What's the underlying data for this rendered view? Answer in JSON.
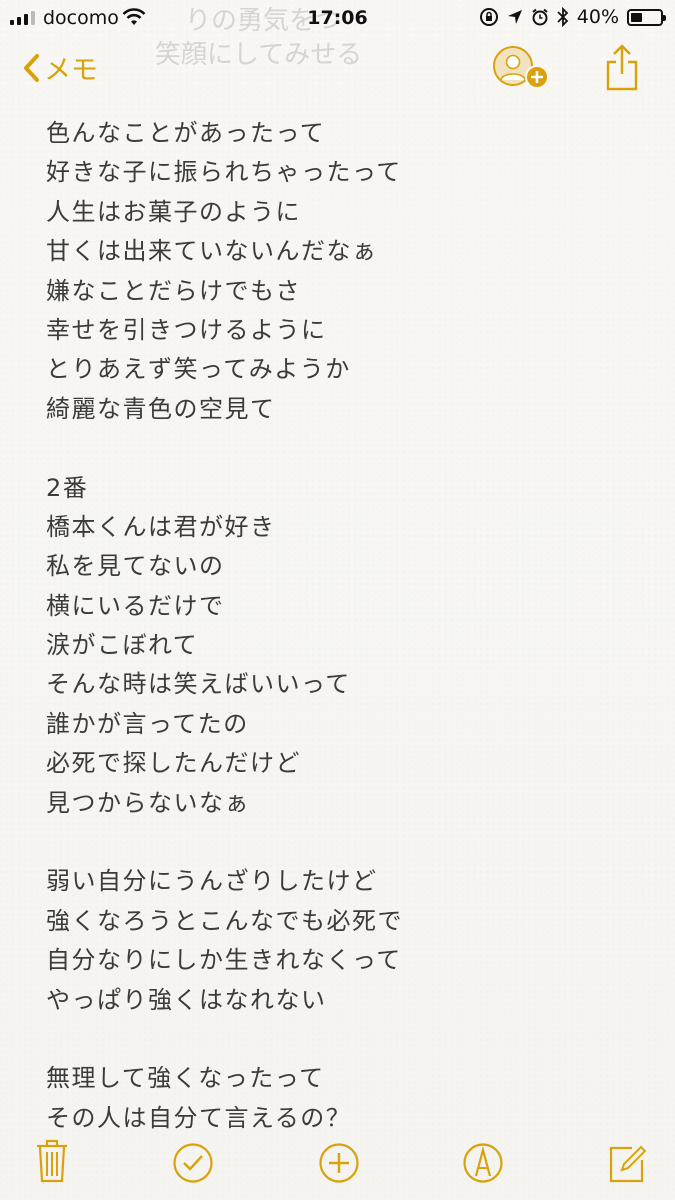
{
  "status_bar": {
    "carrier": "docomo",
    "time": "17:06",
    "battery_percent": "40%",
    "battery_level": 0.4,
    "icons": [
      "signal-icon",
      "wifi-icon",
      "rotation-lock-icon",
      "location-icon",
      "alarm-icon",
      "bluetooth-icon",
      "battery-icon"
    ]
  },
  "nav": {
    "back_label": "メモ",
    "accent": "#d9a20d",
    "ghost_line1": "りの勇気をつ",
    "ghost_line2": "笑顔にしてみせる"
  },
  "note": {
    "lines": [
      "色んなことがあったって",
      "好きな子に振られちゃったって",
      "人生はお菓子のように",
      "甘くは出来ていないんだなぁ",
      "嫌なことだらけでもさ",
      "幸せを引きつけるように",
      "とりあえず笑ってみようか",
      "綺麗な青色の空見て",
      "",
      "2番",
      "橋本くんは君が好き",
      "私を見てないの",
      "横にいるだけで",
      "涙がこぼれて",
      "そんな時は笑えばいいって",
      "誰かが言ってたの",
      "必死で探したんだけど",
      "見つからないなぁ",
      "",
      "弱い自分にうんざりしたけど",
      "強くなろうとこんなでも必死で",
      "自分なりにしか生きれなくって",
      "やっぱり強くはなれない",
      "",
      "無理して強くなったって",
      "その人は自分て言えるの？"
    ]
  },
  "toolbar": {
    "items": [
      "trash-icon",
      "checklist-icon",
      "add-icon",
      "markup-icon",
      "compose-icon"
    ]
  }
}
